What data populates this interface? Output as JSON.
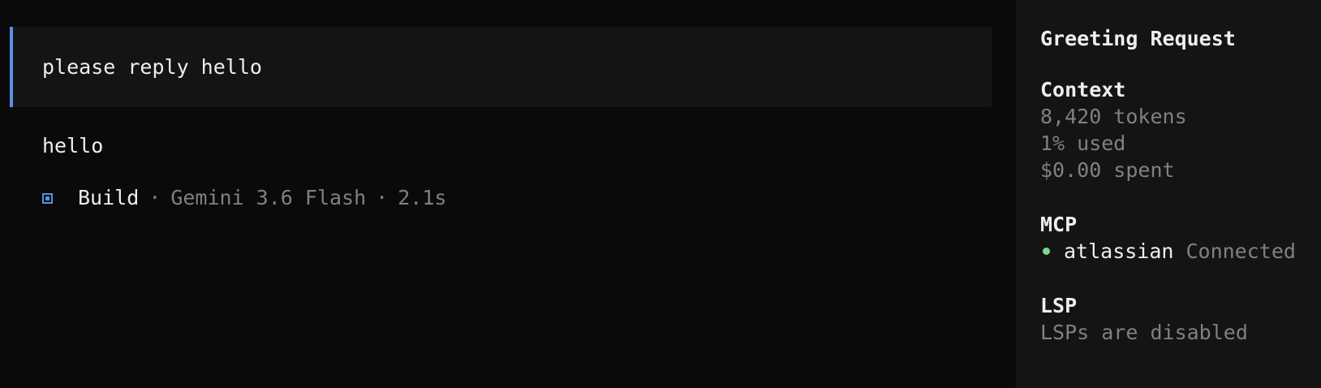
{
  "conversation": {
    "user_message": "please reply hello",
    "assistant_reply": "hello",
    "meta": {
      "agent": "Build",
      "separator": "·",
      "model": "Gemini 3.6 Flash",
      "duration": "2.1s",
      "icon": "agent-square-icon"
    }
  },
  "sidebar": {
    "title": "Greeting Request",
    "context": {
      "heading": "Context",
      "tokens": "8,420 tokens",
      "usage": "1% used",
      "spent": "$0.00 spent"
    },
    "mcp": {
      "heading": "MCP",
      "servers": [
        {
          "name": "atlassian",
          "status": "Connected",
          "status_color": "#7fd88f"
        }
      ]
    },
    "lsp": {
      "heading": "LSP",
      "status": "LSPs are disabled"
    }
  },
  "colors": {
    "background": "#0a0a0a",
    "panel": "#141414",
    "accent": "#5c8fe0",
    "muted_text": "#808080",
    "text": "#eeeeee",
    "success": "#7fd88f"
  }
}
